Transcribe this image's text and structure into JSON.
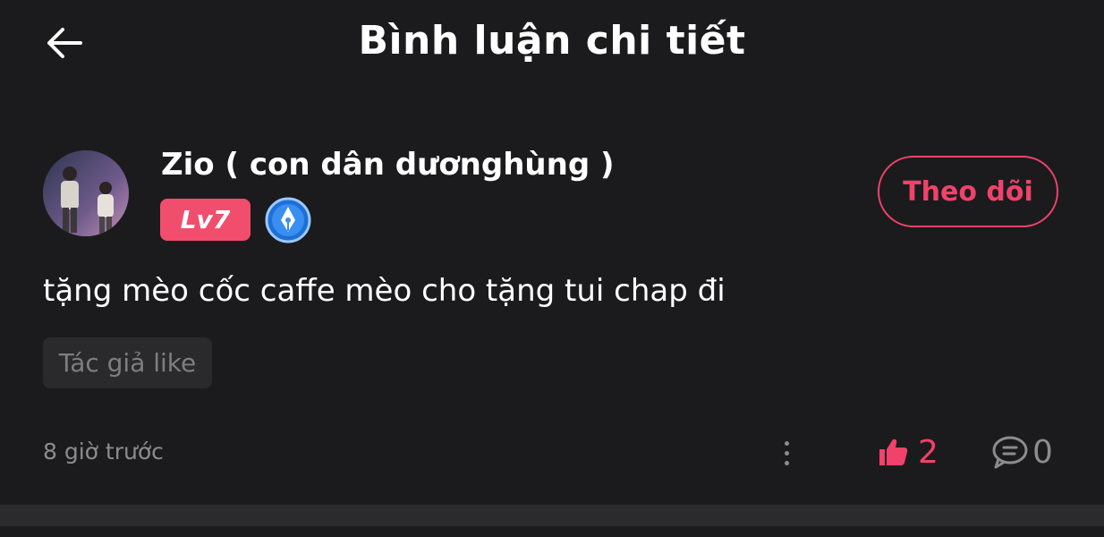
{
  "header": {
    "title": "Bình luận chi tiết",
    "back_icon": "arrow-left-icon"
  },
  "user": {
    "name": "Zio ( con dân dươnghùng )",
    "level": "Lv7",
    "badge_icon": "author-pen-badge-icon",
    "follow_label": "Theo dõi"
  },
  "comment": {
    "text": "tặng mèo cốc caffe mèo cho tặng tui chap đi",
    "tag": "Tác giả like",
    "time": "8 giờ trước",
    "likes": "2",
    "replies": "0"
  },
  "colors": {
    "background": "#1b1b1d",
    "accent": "#f0426a",
    "muted": "#8c8c8e"
  }
}
